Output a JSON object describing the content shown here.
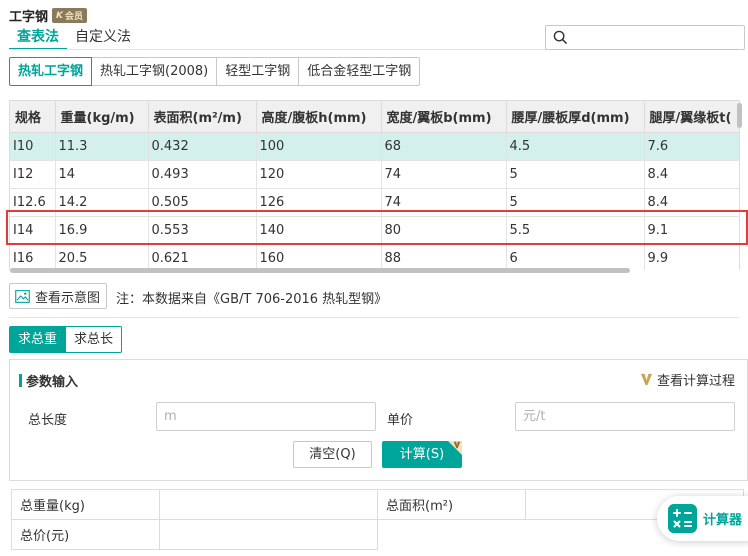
{
  "header": {
    "title": "工字钢",
    "vip_badge": "会员",
    "vip_badge_mark": "K"
  },
  "mode_tabs": [
    "查表法",
    "自定义法"
  ],
  "search": {
    "placeholder": ""
  },
  "type_tabs": [
    "热轧工字钢",
    "热轧工字钢(2008)",
    "轻型工字钢",
    "低合金轻型工字钢"
  ],
  "table": {
    "columns": [
      "规格",
      "重量(kg/m)",
      "表面积(m²/m)",
      "高度/腹板h(mm)",
      "宽度/翼板b(mm)",
      "腰厚/腰板厚d(mm)",
      "腿厚/翼缘板t("
    ],
    "rows": [
      [
        "I10",
        "11.3",
        "0.432",
        "100",
        "68",
        "4.5",
        "7.6"
      ],
      [
        "I12",
        "14",
        "0.493",
        "120",
        "74",
        "5",
        "8.4"
      ],
      [
        "I12.6",
        "14.2",
        "0.505",
        "126",
        "74",
        "5",
        "8.4"
      ],
      [
        "I14",
        "16.9",
        "0.553",
        "140",
        "80",
        "5.5",
        "9.1"
      ],
      [
        "I16",
        "20.5",
        "0.621",
        "160",
        "88",
        "6",
        "9.9"
      ]
    ],
    "selected_row": 0,
    "highlighted_row": 3
  },
  "diagram_button": "查看示意图",
  "note": "注：本数据来自《GB/T 706-2016 热轧型钢》",
  "calc_tabs": [
    "求总重",
    "求总长"
  ],
  "params": {
    "title": "参数输入",
    "view_process": "查看计算过程",
    "length_label": "总长度",
    "length_placeholder": "m",
    "price_label": "单价",
    "price_placeholder": "元/t",
    "clear_button": "清空(Q)",
    "calc_button": "计算(S)"
  },
  "results": {
    "total_weight_label": "总重量(kg)",
    "total_area_label": "总面积(m²)",
    "total_price_label": "总价(元)"
  },
  "float_button": "计算器",
  "colors": {
    "accent": "#00a59a",
    "selected_row": "#d4f0ec",
    "highlight": "#e23b3b"
  }
}
